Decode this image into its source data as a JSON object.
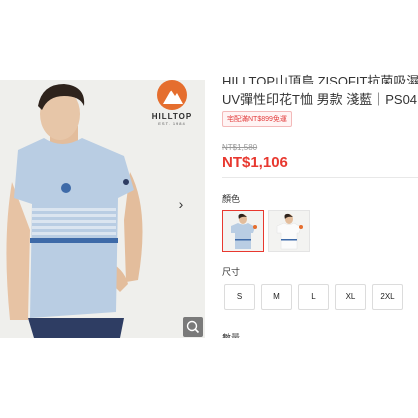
{
  "product": {
    "title_line1": "HILLTOP山頂鳥 ZISOFIT抗菌吸濕",
    "title_line2": "UV彈性印花T恤 男款 淺藍｜PS04",
    "promo_badge": "宅配滿NT$899免運",
    "original_price": "NT$1,580",
    "sale_price": "NT$1,106"
  },
  "brand": {
    "name": "HILLTOP",
    "tagline": "EST. 1984",
    "accent_color": "#e56e2e"
  },
  "gallery": {
    "next_icon": "chevron-right-icon",
    "zoom_icon": "magnifier-icon"
  },
  "options": {
    "color_label": "顏色",
    "colors": [
      "淺藍",
      "白色"
    ],
    "size_label": "尺寸",
    "sizes": [
      "S",
      "M",
      "L",
      "XL",
      "2XL"
    ],
    "quantity_label": "數量"
  },
  "colors": {
    "price_red": "#e8382f",
    "shirt_blue": "#b9cde3",
    "stripe_blue": "#3e6aa8"
  }
}
